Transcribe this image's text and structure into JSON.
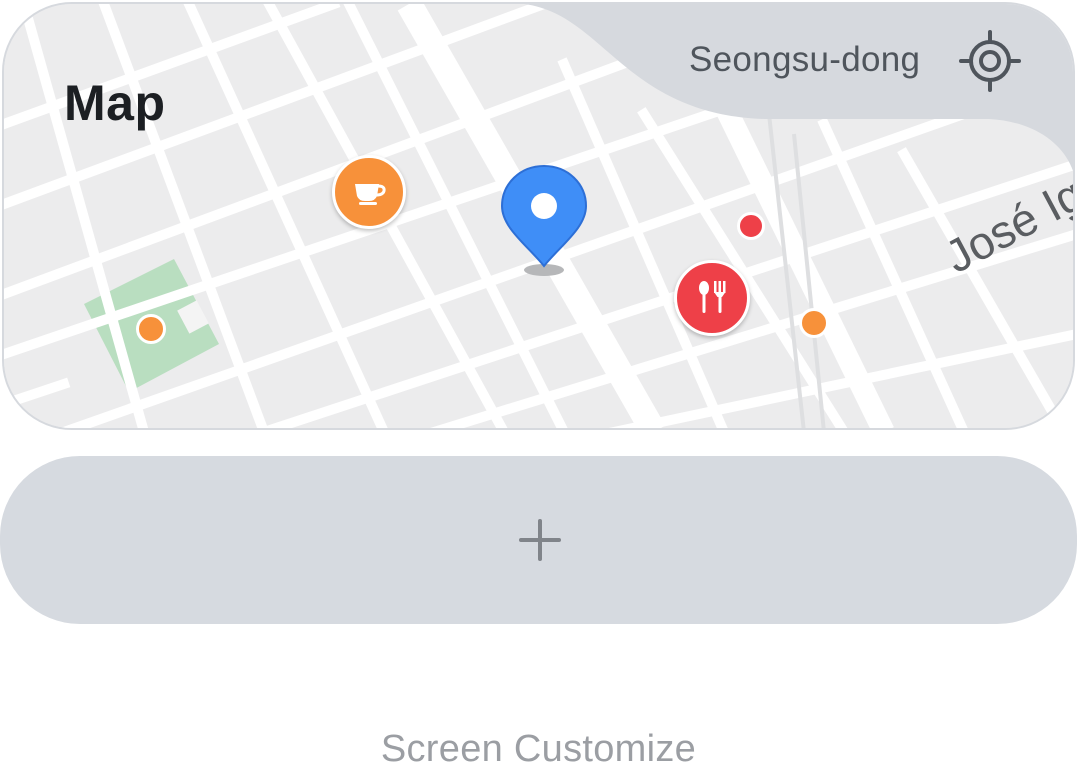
{
  "map_widget": {
    "title": "Map",
    "location_label": "Seongsu-dong",
    "street_label": "José Igr"
  },
  "add_widget": {
    "icon": "plus-icon"
  },
  "footer": {
    "customize_label": "Screen Customize"
  },
  "colors": {
    "map_background": "#ececed",
    "park": "#b9dec0",
    "pin_blue": "#3f8ef7",
    "cafe_orange": "#f7913a",
    "restaurant_red": "#ee4048",
    "widget_bar": "#d6dae0"
  }
}
